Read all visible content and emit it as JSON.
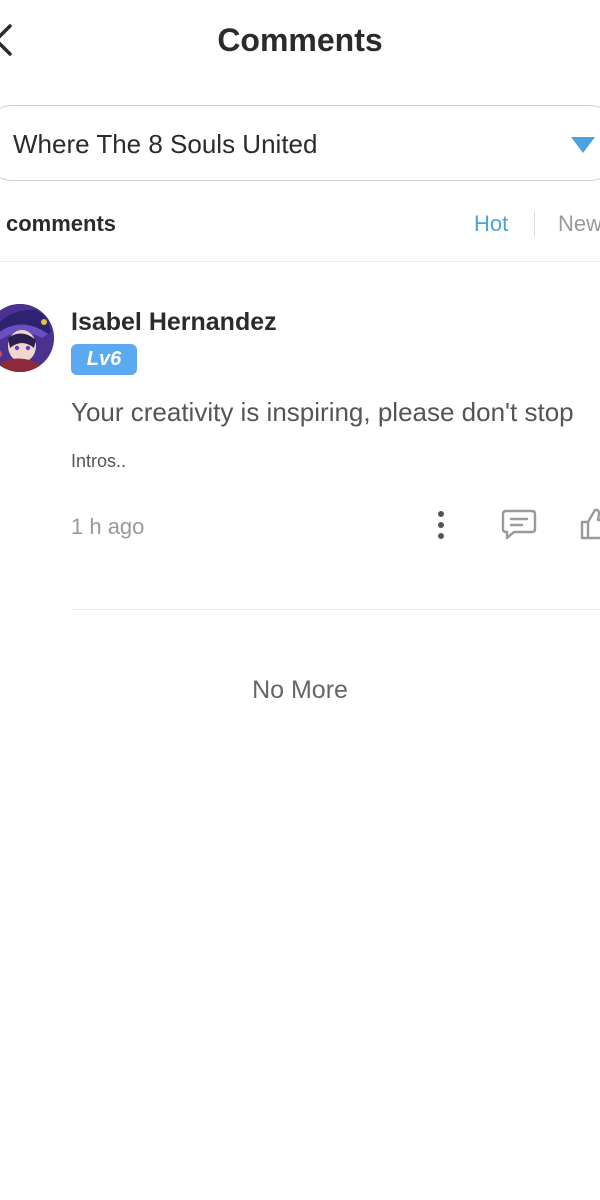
{
  "header": {
    "title": "Comments",
    "back_icon": "chevron-left-icon"
  },
  "chapter_selector": {
    "selected": "Where The 8 Souls United",
    "icon": "triangle-down-icon",
    "accent_color": "#4aa3df"
  },
  "comments_bar": {
    "count_label": "comments",
    "tabs": [
      {
        "label": "Hot",
        "active": true,
        "color": "#4aa3df"
      },
      {
        "label": "New",
        "active": false,
        "color": "#9a9a9a"
      }
    ]
  },
  "comments": [
    {
      "author": "Isabel Hernandez",
      "level": "Lv6",
      "level_color": "#5aaaf0",
      "text": "Your creativity is inspiring, please don't stop",
      "tag": "Intros..",
      "time": "1 h ago",
      "actions": [
        "more-vertical-icon",
        "reply-icon",
        "like-icon"
      ]
    }
  ],
  "footer": {
    "no_more": "No More"
  }
}
